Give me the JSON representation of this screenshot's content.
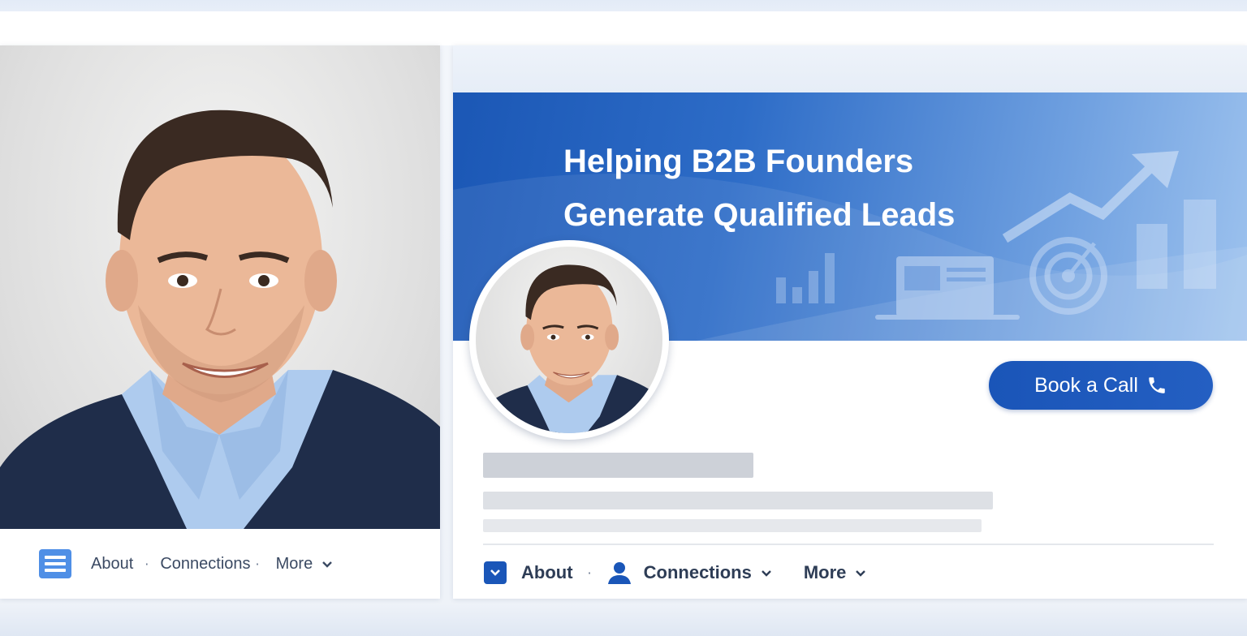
{
  "left_profile": {
    "nav": {
      "about": "About",
      "connections": "Connections",
      "more": "More",
      "separator": "·"
    }
  },
  "right_profile": {
    "banner": {
      "headline_line1": "Helping B2B Founders",
      "headline_line2": "Generate Qualified Leads",
      "background_color": "#1b57b5"
    },
    "cta": {
      "label": "Book a Call",
      "icon": "phone-icon",
      "color": "#1a55b8"
    },
    "nav": {
      "about": "About",
      "connections": "Connections",
      "more": "More",
      "separator": "·"
    }
  },
  "icons": {
    "left_menu": "menu-icon",
    "about": "chevron-box-icon",
    "connections": "person-icon",
    "dropdown": "chevron-down-icon"
  }
}
